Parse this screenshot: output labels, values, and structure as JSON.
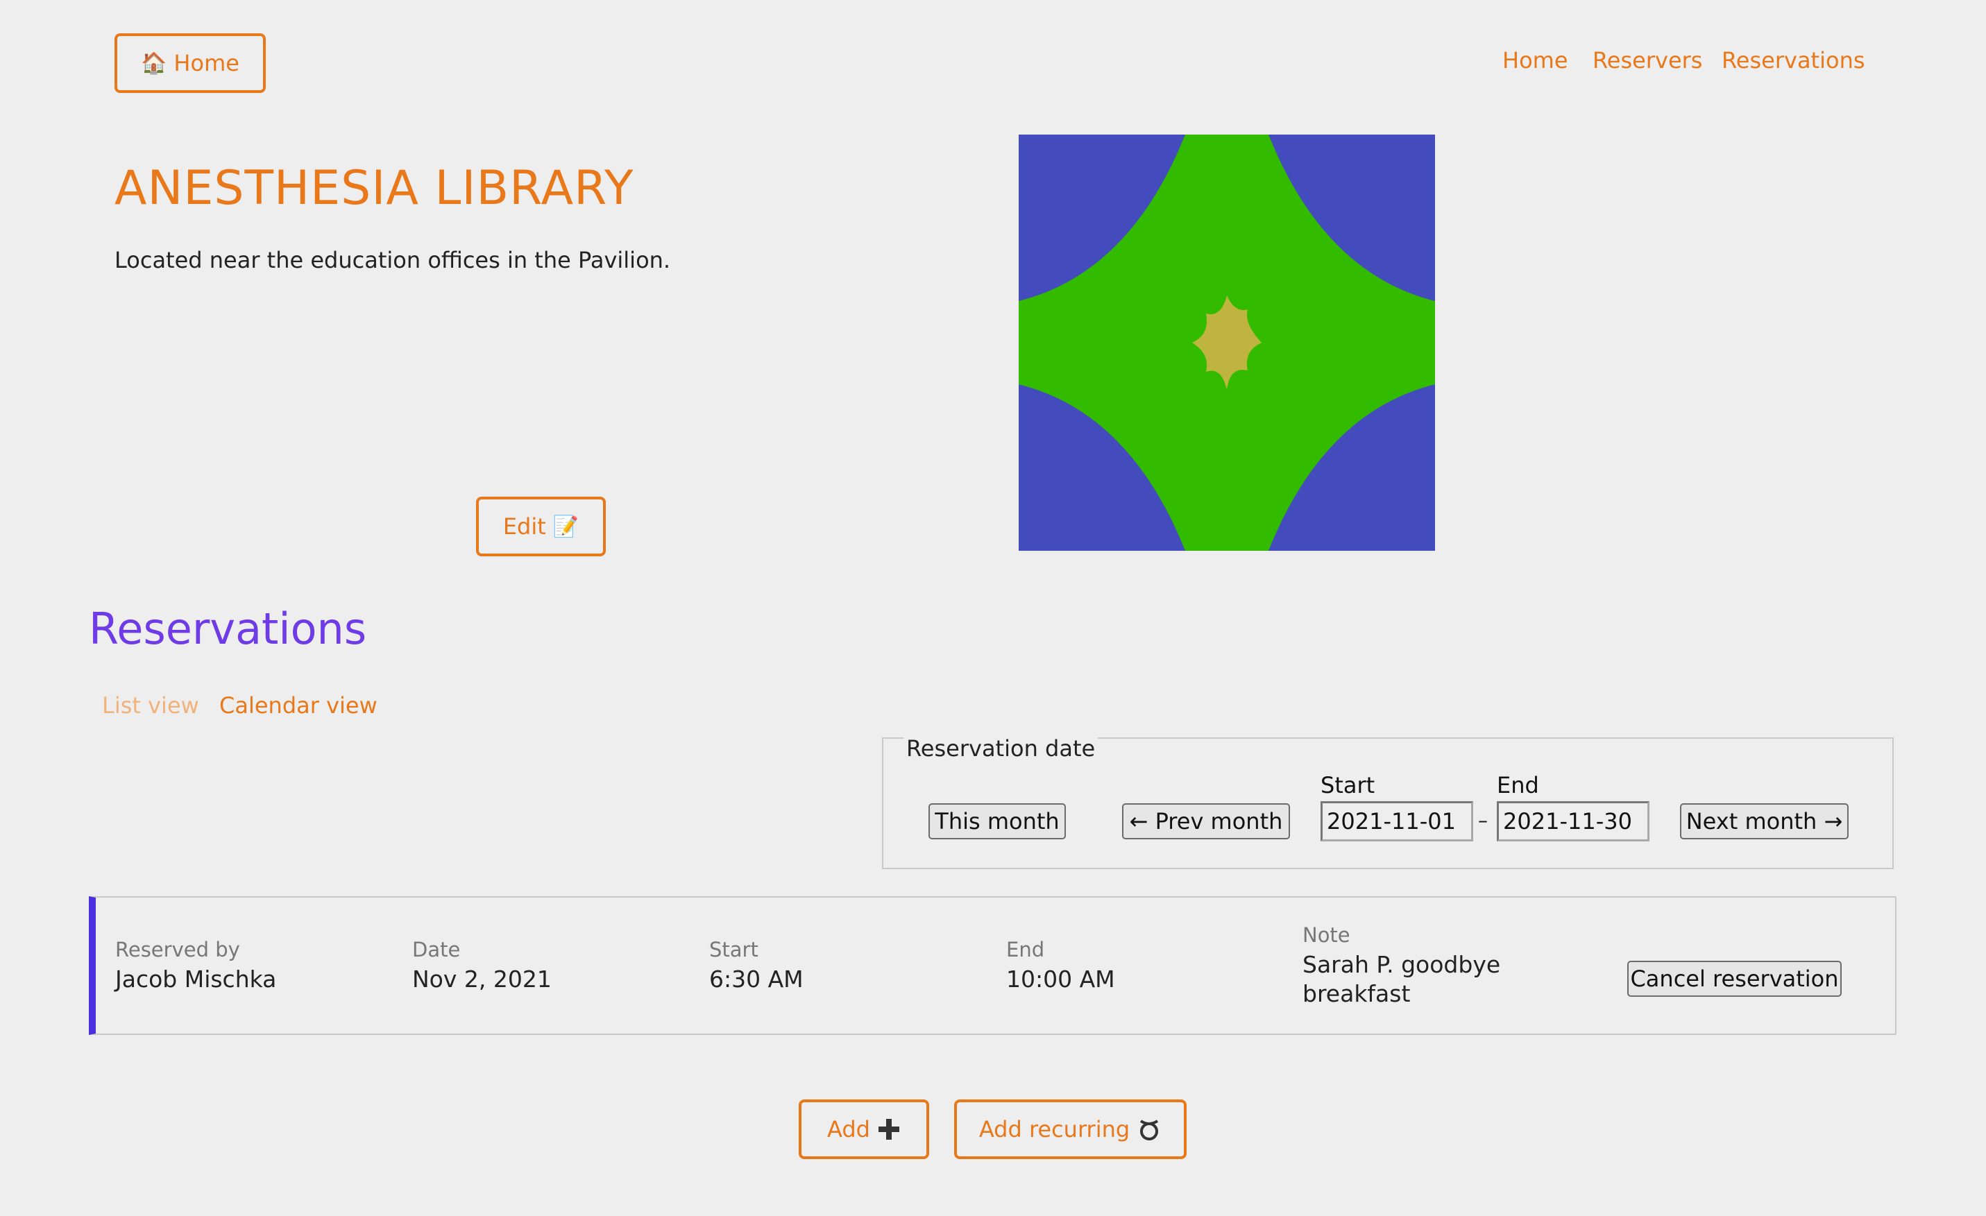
{
  "header": {
    "home_button": {
      "icon": "house-emoji-icon",
      "label": "Home"
    },
    "nav": [
      {
        "label": "Home"
      },
      {
        "label": "Reservers"
      },
      {
        "label": "Reservations"
      }
    ]
  },
  "resource": {
    "title": "ANESTHESIA LIBRARY",
    "description": "Located near the education offices in the Pavilion.",
    "edit_button": {
      "label": "Edit",
      "icon": "memo-emoji-icon"
    },
    "avatar_colors": {
      "background": "#444cbd",
      "shape": "#33bb00",
      "center": "#c0b440"
    }
  },
  "reservations": {
    "heading": "Reservations",
    "tabs": [
      {
        "label": "List view",
        "active": true
      },
      {
        "label": "Calendar view",
        "active": false
      }
    ],
    "filter": {
      "legend": "Reservation date",
      "this_month": "This month",
      "prev_month": "← Prev month",
      "start_label": "Start",
      "start_value": "2021-11-01",
      "separator": "–",
      "end_label": "End",
      "end_value": "2021-11-30",
      "next_month": "Next month →"
    },
    "columns": [
      "Reserved by",
      "Date",
      "Start",
      "End",
      "Note"
    ],
    "items": [
      {
        "reserved_by": "Jacob Mischka",
        "date": "Nov 2, 2021",
        "start": "6:30 AM",
        "end": "10:00 AM",
        "note_line1": "Sarah P. goodbye",
        "note_line2": "breakfast",
        "cancel_label": "Cancel reservation"
      }
    ],
    "add_button": {
      "label": "Add",
      "icon": "plus-icon"
    },
    "add_recurring_button": {
      "label": "Add recurring",
      "icon": "recurring-loop-icon"
    }
  },
  "colors": {
    "accent": "#e8781a",
    "heading": "#6f3be6",
    "card_stripe": "#4b2fe0",
    "tab_inactive": "#f0b27a"
  }
}
